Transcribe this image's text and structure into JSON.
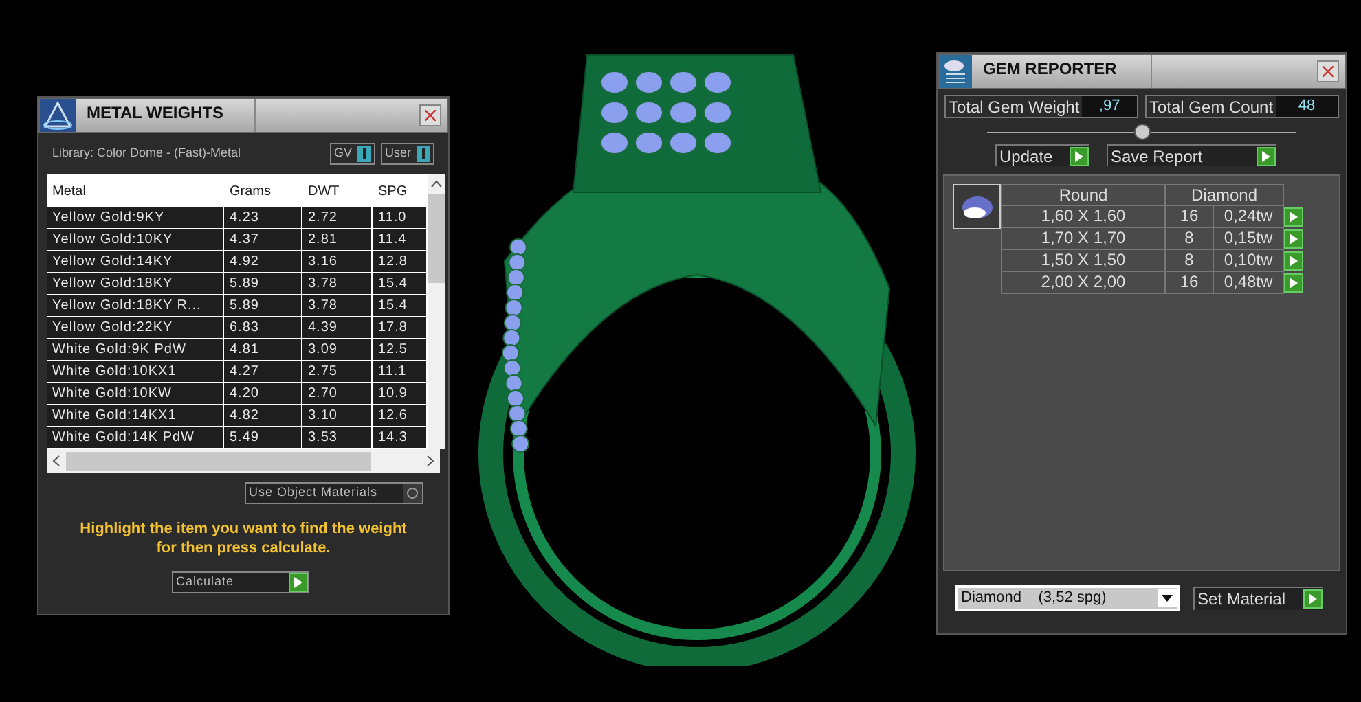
{
  "metal_weights": {
    "title": "METAL WEIGHTS",
    "library": "Library: Color Dome - (Fast)-Metal",
    "toggles": [
      {
        "label": "GV",
        "on": true
      },
      {
        "label": "User",
        "on": true
      }
    ],
    "table": {
      "columns": [
        "Metal",
        "Grams",
        "DWT",
        "SPG"
      ],
      "rows": [
        [
          "Yellow Gold:9KY",
          "4.23",
          "2.72",
          "11.0"
        ],
        [
          "Yellow Gold:10KY",
          "4.37",
          "2.81",
          "11.4"
        ],
        [
          "Yellow Gold:14KY",
          "4.92",
          "3.16",
          "12.8"
        ],
        [
          "Yellow Gold:18KY",
          "5.89",
          "3.78",
          "15.4"
        ],
        [
          "Yellow Gold:18KY R...",
          "5.89",
          "3.78",
          "15.4"
        ],
        [
          "Yellow Gold:22KY",
          "6.83",
          "4.39",
          "17.8"
        ],
        [
          "White Gold:9K PdW",
          "4.81",
          "3.09",
          "12.5"
        ],
        [
          "White Gold:10KX1",
          "4.27",
          "2.75",
          "11.1"
        ],
        [
          "White Gold:10KW",
          "4.20",
          "2.70",
          "10.9"
        ],
        [
          "White Gold:14KX1",
          "4.82",
          "3.10",
          "12.6"
        ],
        [
          "White Gold:14K PdW",
          "5.49",
          "3.53",
          "14.3"
        ]
      ]
    },
    "use_object_materials": {
      "label": "Use Object Materials",
      "checked": false
    },
    "hint": "Highlight the item you want to find the weight for then press calculate.",
    "calculate": "Calculate"
  },
  "gem_reporter": {
    "title": "GEM REPORTER",
    "total_gem_weight": {
      "label": "Total Gem Weight",
      "value": ",97"
    },
    "total_gem_count": {
      "label": "Total Gem Count",
      "value": "48"
    },
    "update": "Update",
    "save_report": "Save Report",
    "gem_list": {
      "shape": "Round",
      "material": "Diamond",
      "gems": [
        {
          "size": "1,60 X 1,60",
          "count": "16",
          "weight": "0,24tw"
        },
        {
          "size": "1,70 X 1,70",
          "count": "8",
          "weight": "0,15tw"
        },
        {
          "size": "1,50 X 1,50",
          "count": "8",
          "weight": "0,10tw"
        },
        {
          "size": "2,00 X 2,00",
          "count": "16",
          "weight": "0,48tw"
        }
      ]
    },
    "material": "Diamond    (3,52 spg)",
    "set_material": "Set Material"
  }
}
